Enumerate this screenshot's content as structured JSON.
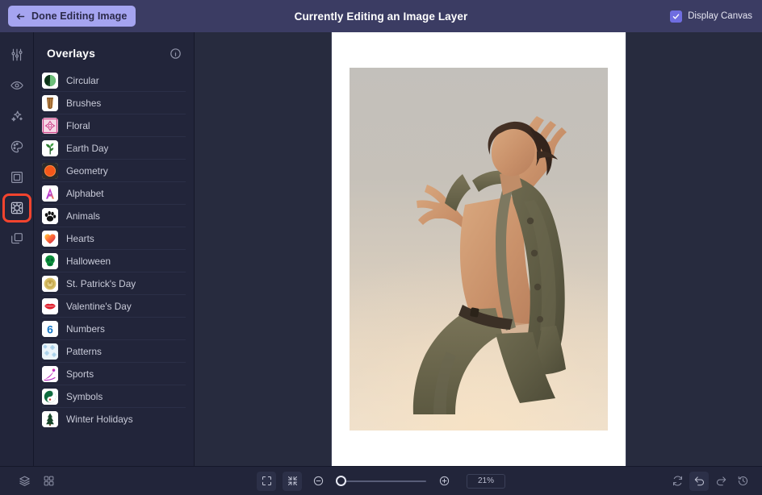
{
  "topbar": {
    "done_button_label": "Done Editing Image",
    "title": "Currently Editing an Image Layer",
    "display_canvas_label": "Display Canvas",
    "display_canvas_checked": true,
    "accent_button_bg": "#a5a4f0",
    "bar_bg": "#3b3c63"
  },
  "rail": {
    "items": [
      {
        "name": "adjust-icon",
        "tooltip": "Adjust"
      },
      {
        "name": "eye-icon",
        "tooltip": "Effects"
      },
      {
        "name": "sparkle-icon",
        "tooltip": "AI Tools"
      },
      {
        "name": "palette-icon",
        "tooltip": "Color"
      },
      {
        "name": "frame-icon",
        "tooltip": "Frames"
      },
      {
        "name": "overlays-icon",
        "tooltip": "Overlays"
      },
      {
        "name": "layers-copy-icon",
        "tooltip": "Duplicate"
      }
    ],
    "selected_index": 5,
    "highlight_color": "#f4442e"
  },
  "panel": {
    "title": "Overlays",
    "info_icon": "info-icon",
    "items": [
      {
        "label": "Circular",
        "thumb": "circular-thumb"
      },
      {
        "label": "Brushes",
        "thumb": "brushes-thumb"
      },
      {
        "label": "Floral",
        "thumb": "floral-thumb"
      },
      {
        "label": "Earth Day",
        "thumb": "earth-day-thumb"
      },
      {
        "label": "Geometry",
        "thumb": "geometry-thumb"
      },
      {
        "label": "Alphabet",
        "thumb": "alphabet-thumb"
      },
      {
        "label": "Animals",
        "thumb": "animals-thumb"
      },
      {
        "label": "Hearts",
        "thumb": "hearts-thumb"
      },
      {
        "label": "Halloween",
        "thumb": "halloween-thumb"
      },
      {
        "label": "St. Patrick's Day",
        "thumb": "st-patricks-thumb"
      },
      {
        "label": "Valentine's Day",
        "thumb": "valentines-thumb"
      },
      {
        "label": "Numbers",
        "thumb": "numbers-thumb"
      },
      {
        "label": "Patterns",
        "thumb": "patterns-thumb"
      },
      {
        "label": "Sports",
        "thumb": "sports-thumb"
      },
      {
        "label": "Symbols",
        "thumb": "symbols-thumb"
      },
      {
        "label": "Winter Holidays",
        "thumb": "winter-holidays-thumb"
      }
    ]
  },
  "canvas": {
    "background": "#272b3e",
    "paper_background": "#ffffff",
    "image_description": "Person in olive blazer and trousers posing with arms raised against warm beige backdrop"
  },
  "bottombar": {
    "layers_icon": "layers-icon",
    "grid_icon": "grid-icon",
    "fit_icon": "fit-to-screen-icon",
    "fill_icon": "shrink-to-fit-icon",
    "zoom_out_icon": "zoom-out-icon",
    "zoom_in_icon": "zoom-in-icon",
    "zoom_value": "21%",
    "zoom_slider_percent": 4,
    "reset_icon": "reset-icon",
    "undo_icon": "undo-icon",
    "redo_icon": "redo-icon",
    "history_icon": "history-icon"
  }
}
